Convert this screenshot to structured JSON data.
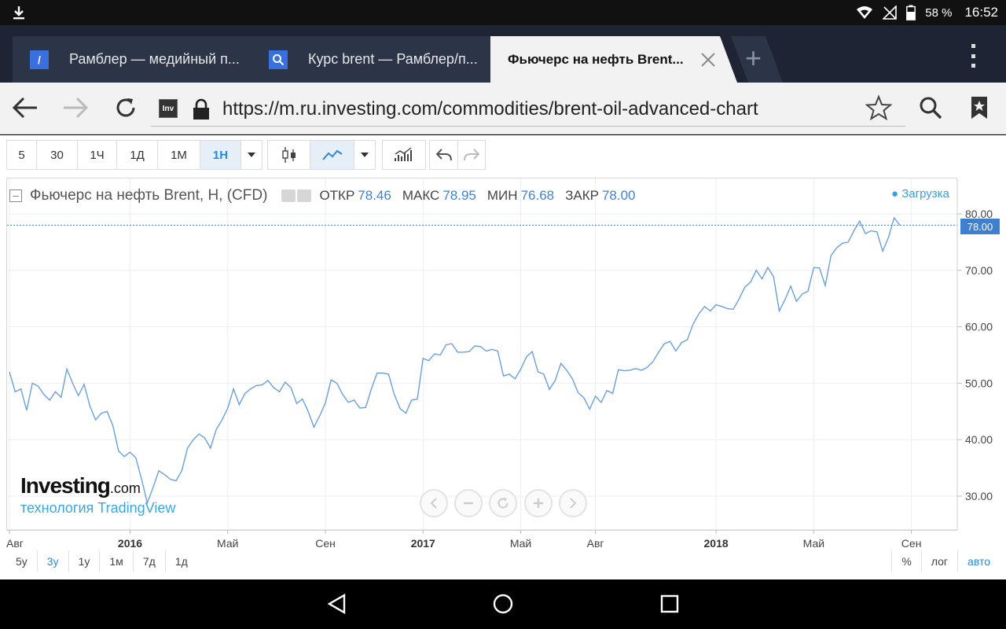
{
  "status": {
    "battery": "58 %",
    "time": "16:52"
  },
  "tabs": [
    {
      "title": "Рамблер — медийный п...",
      "fav": "/"
    },
    {
      "title": "Курс brent — Рамблер/п...",
      "fav": "search-icon"
    },
    {
      "title": "Фьючерс на нефть Brent..."
    }
  ],
  "newtab_label": "+",
  "url": "https://m.ru.investing.com/commodities/brent-oil-advanced-chart",
  "site_badge": "Inv",
  "intervals": [
    "5",
    "30",
    "1Ч",
    "1Д",
    "1М",
    "1Н"
  ],
  "selected_interval": "1Н",
  "legend": {
    "title": "Фьючерс на нефть Brent, Н, (CFD)",
    "open_label": "ОТКР",
    "open": "78.46",
    "high_label": "МАКС",
    "high": "78.95",
    "low_label": "МИН",
    "low": "76.68",
    "close_label": "ЗАКР",
    "close": "78.00"
  },
  "loading": "● Загрузка",
  "logo": {
    "brand": "Investing",
    "suffix": ".com",
    "tagline": "технология TradingView"
  },
  "ranges": [
    "5y",
    "3y",
    "1y",
    "1м",
    "7д",
    "1д"
  ],
  "selected_range": "3y",
  "scale_options": [
    "%",
    "лог",
    "авто"
  ],
  "chart_data": {
    "type": "line",
    "ylim": [
      24,
      85
    ],
    "yticks": [
      "80.00",
      "70.00",
      "60.00",
      "50.00",
      "40.00",
      "30.00"
    ],
    "ytick_values": [
      80,
      70,
      60,
      50,
      40,
      30
    ],
    "xticks": [
      "Авг",
      "2016",
      "Май",
      "Сен",
      "2017",
      "Май",
      "Авг",
      "2018",
      "Май",
      "Сен"
    ],
    "xtick_index": [
      0,
      21,
      38,
      55,
      72,
      89,
      102,
      123,
      140,
      157
    ],
    "last_price": "78.00",
    "last_value": 78.0,
    "accent": "#6a9fde",
    "values": [
      52,
      48.5,
      49,
      45.2,
      50,
      49.5,
      48,
      47,
      48.5,
      47.5,
      52.5,
      50,
      47.8,
      49.8,
      46,
      43.5,
      44.7,
      45,
      42.5,
      38,
      37,
      37.8,
      36.8,
      33,
      28.8,
      31.5,
      34.5,
      33.8,
      33,
      32.7,
      34.5,
      38.5,
      40,
      41,
      40.3,
      38.5,
      41.8,
      43.5,
      45.6,
      49,
      46.2,
      48.2,
      49,
      49.6,
      49.7,
      50.5,
      49.2,
      48.5,
      50.2,
      49.2,
      46.4,
      47.2,
      45,
      42.2,
      44.2,
      46.5,
      50.6,
      50,
      48,
      46.6,
      47,
      45.6,
      45.7,
      49,
      51.8,
      51.8,
      51.6,
      48,
      45.5,
      44.7,
      47,
      47.2,
      54.4,
      54,
      55.2,
      55,
      56.8,
      57,
      55.5,
      55.5,
      55.6,
      56.6,
      56.5,
      55.7,
      56,
      55.7,
      51.3,
      51.6,
      50.8,
      52.5,
      54.7,
      55.6,
      52,
      51.6,
      48.9,
      50.5,
      53.5,
      52.3,
      50.8,
      48.3,
      47.4,
      45.4,
      47.7,
      46.6,
      48.7,
      48.2,
      52.4,
      52.2,
      52.3,
      52.6,
      52.3,
      52.8,
      53.8,
      55.5,
      57,
      57.4,
      55.7,
      57.2,
      57.7,
      60.5,
      62.3,
      63.6,
      62.8,
      63.9,
      63.6,
      63.2,
      63.1,
      64.9,
      67,
      67.9,
      70,
      68.5,
      70.5,
      68.9,
      62.8,
      64.8,
      67.2,
      64.5,
      65.8,
      66.3,
      70.5,
      70.4,
      67.3,
      72.6,
      74,
      74.8,
      75,
      77,
      78.7,
      76.5,
      77,
      76.8,
      73.4,
      75.8,
      79.3,
      78
    ]
  }
}
